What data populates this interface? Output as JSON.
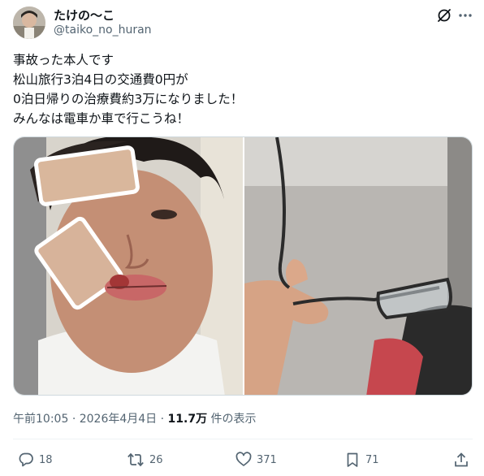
{
  "user": {
    "display_name": "たけの〜こ",
    "handle": "@taiko_no_huran"
  },
  "tweet": {
    "lines": [
      "事故った本人です",
      "松山旅行3泊4日の交通費0円が",
      "0泊日帰りの治療費約3万になりました！",
      "みんなは電車か車で行こうね！"
    ]
  },
  "meta": {
    "time": "午前10:05",
    "separator": "·",
    "date": "2026年4月4日",
    "views": "11.7万",
    "views_label": "件の表示"
  },
  "actions": {
    "replies": "18",
    "reposts": "26",
    "likes": "371",
    "bookmarks": "71"
  },
  "icons": {
    "grok": "grok-slash-icon",
    "more": "more-dots-icon",
    "reply": "reply-bubble-icon",
    "repost": "repost-arrows-icon",
    "like": "heart-icon",
    "bookmark": "bookmark-icon",
    "share": "share-upload-icon"
  }
}
